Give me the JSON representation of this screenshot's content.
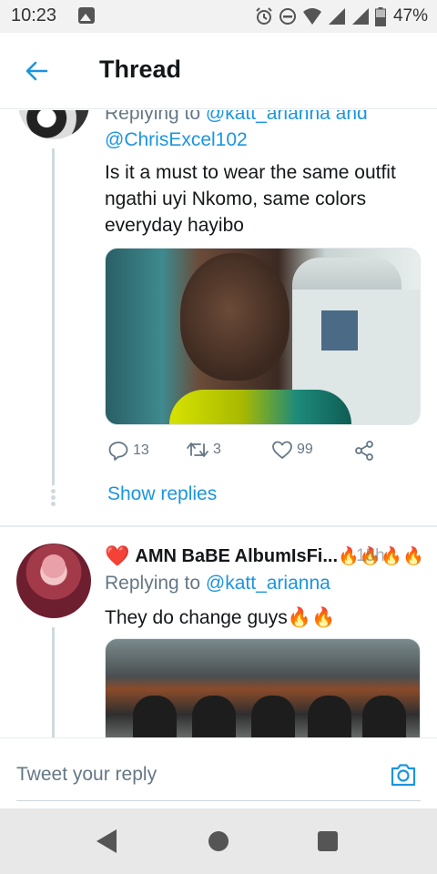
{
  "status_bar": {
    "time": "10:23",
    "battery": "47%",
    "icons": [
      "gallery-icon",
      "alarm-icon",
      "dnd-icon",
      "wifi-icon",
      "signal-icon",
      "signal-icon",
      "battery-icon"
    ]
  },
  "header": {
    "title": "Thread",
    "back_icon": "back-arrow-icon"
  },
  "tweets": [
    {
      "replying_prefix": "Replying to",
      "mention_1": "@katt_arianna",
      "and": "and",
      "mention_2": "@ChrisExcel102",
      "text": "Is it a must to wear the same outfit ngathi uyi Nkomo, same colors everyday hayibo",
      "stats": {
        "replies": "13",
        "retweets": "3",
        "likes": "99"
      },
      "show_replies": "Show replies"
    },
    {
      "name_prefix": "❤️",
      "name": "AMN BaBE AlbumIsFi...",
      "name_emojis": "🔥🔥🔥🔥",
      "timestamp": "15h",
      "replying_prefix": "Replying to",
      "mention_1": "@katt_arianna",
      "text": "They do change guys🔥🔥"
    }
  ],
  "reply_box": {
    "placeholder": "Tweet your reply",
    "camera_icon": "camera-icon"
  },
  "nav_bar": {
    "icons": [
      "nav-back-icon",
      "nav-home-icon",
      "nav-recents-icon"
    ]
  },
  "colors": {
    "accent": "#1b95e0",
    "text": "#14171a",
    "muted": "#657786",
    "heart": "#e0245e"
  }
}
